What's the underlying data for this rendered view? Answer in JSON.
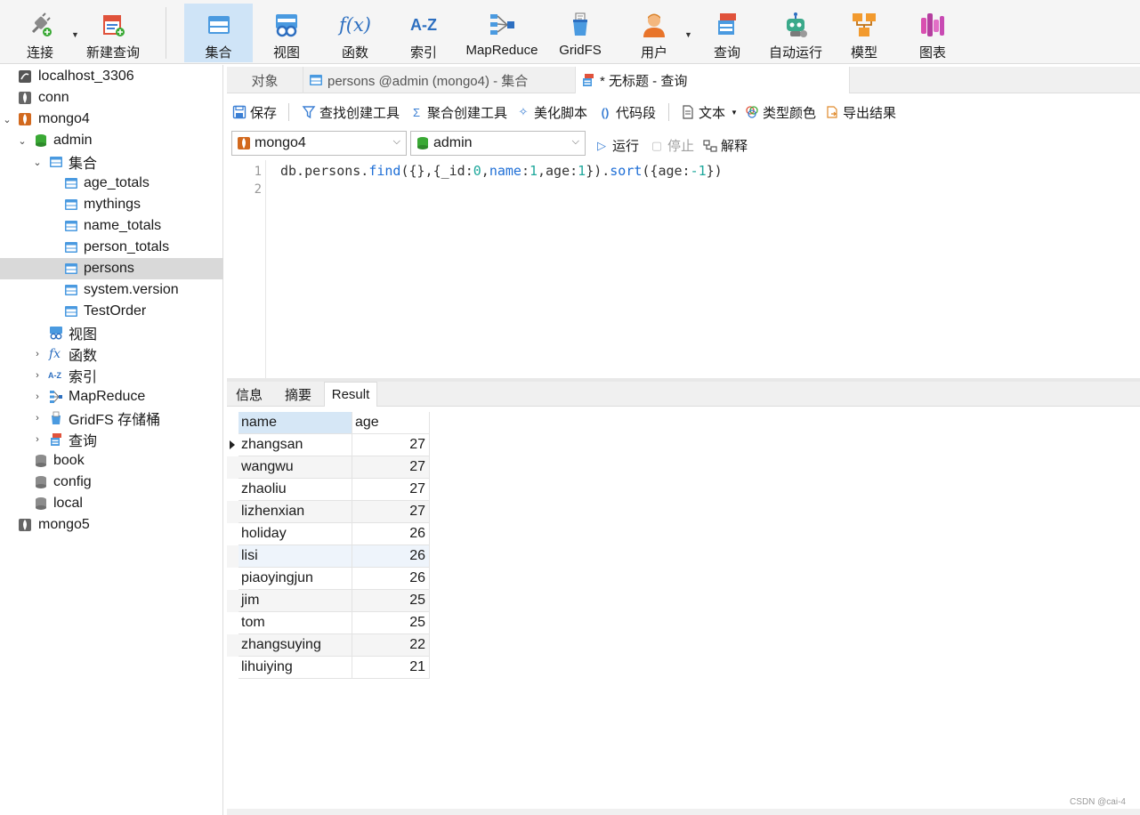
{
  "toolbar": {
    "connect": "连接",
    "new_query": "新建查询",
    "collection": "集合",
    "view": "视图",
    "function": "函数",
    "index": "索引",
    "mapreduce": "MapReduce",
    "gridfs": "GridFS",
    "user": "用户",
    "query": "查询",
    "auto_run": "自动运行",
    "model": "模型",
    "chart": "图表",
    "index_glyph": "A-Z",
    "function_glyph": "f(x)"
  },
  "sidebar": {
    "connection_1": "localhost_3306",
    "connection_2": "conn",
    "connection_3": "mongo4",
    "database_admin": "admin",
    "group_collections": "集合",
    "collections": [
      "age_totals",
      "mythings",
      "name_totals",
      "person_totals",
      "persons",
      "system.version",
      "TestOrder"
    ],
    "group_views": "视图",
    "group_functions": "函数",
    "group_indexes": "索引",
    "group_mapreduce": "MapReduce",
    "group_gridfs": "GridFS 存储桶",
    "group_queries": "查询",
    "database_book": "book",
    "database_config": "config",
    "database_local": "local",
    "connection_4": "mongo5"
  },
  "tabs": {
    "objects": "对象",
    "persons": "persons @admin (mongo4) - 集合",
    "untitled": "* 无标题 - 查询"
  },
  "editor_toolbar": {
    "save": "保存",
    "find_builder": "查找创建工具",
    "aggregate_builder": "聚合创建工具",
    "beautify": "美化脚本",
    "snippet": "代码段",
    "text": "文本",
    "type_color": "类型颜色",
    "export": "导出结果",
    "run": "运行",
    "stop": "停止",
    "explain": "解释"
  },
  "selectors": {
    "connection": "mongo4",
    "database": "admin"
  },
  "editor": {
    "line_numbers": [
      "1",
      "2"
    ],
    "code": {
      "t1": "db.persons.",
      "t2": "find",
      "t3": "({},{",
      "t4": "_id",
      "t5": ":",
      "t6": "0",
      "t7": ",",
      "t8": "name",
      "t9": ":",
      "t10": "1",
      "t11": ",age:",
      "t12": "1",
      "t13": "}).",
      "t14": "sort",
      "t15": "({age:",
      "t16": "-1",
      "t17": "})"
    }
  },
  "result_tabs": {
    "info": "信息",
    "summary": "摘要",
    "result": "Result"
  },
  "result_grid": {
    "columns": [
      "name",
      "age"
    ],
    "rows": [
      {
        "name": "zhangsan",
        "age": "27"
      },
      {
        "name": "wangwu",
        "age": "27"
      },
      {
        "name": "zhaoliu",
        "age": "27"
      },
      {
        "name": "lizhenxian",
        "age": "27"
      },
      {
        "name": "holiday",
        "age": "26"
      },
      {
        "name": "lisi",
        "age": "26"
      },
      {
        "name": "piaoyingjun",
        "age": "26"
      },
      {
        "name": "jim",
        "age": "25"
      },
      {
        "name": "tom",
        "age": "25"
      },
      {
        "name": "zhangsuying",
        "age": "22"
      },
      {
        "name": "lihuiying",
        "age": "21"
      }
    ]
  },
  "watermark": "CSDN @cai-4",
  "colors": {
    "accent_blue": "#1f6fd6",
    "active_tool": "#cfe4f7",
    "selected_row": "#d9d9d9",
    "number_teal": "#1fa89c"
  }
}
